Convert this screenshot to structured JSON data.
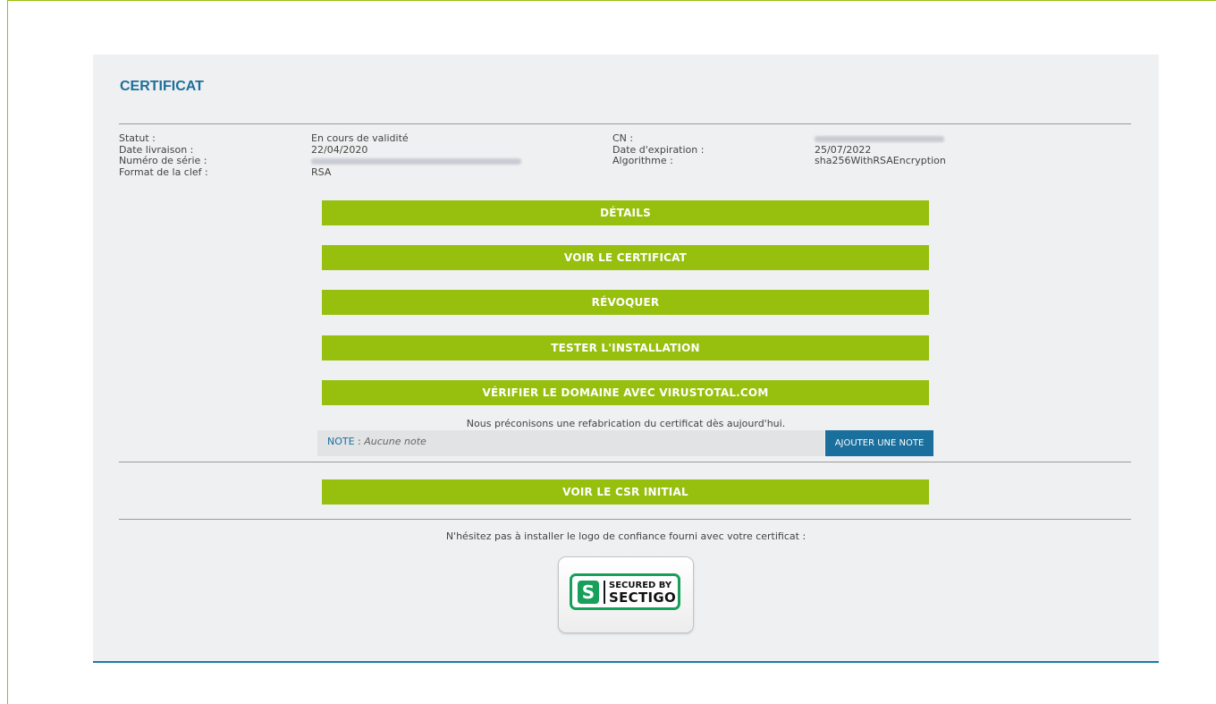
{
  "certificate": {
    "title": "CERTIFICAT",
    "left_labels": {
      "status": "Statut :",
      "delivery": "Date livraison :",
      "serial": "Numéro de série :",
      "key_format": "Format de la clef :"
    },
    "left_values": {
      "status": "En cours de validité",
      "delivery": "22/04/2020",
      "key_format": "RSA"
    },
    "right_labels": {
      "cn": "CN :",
      "expiration": "Date d'expiration :",
      "algorithm": "Algorithme :"
    },
    "right_values": {
      "expiration": "25/07/2022",
      "algorithm": "sha256WithRSAEncryption"
    }
  },
  "actions": {
    "details": "DÉTAILS",
    "view_certificate": "VOIR LE CERTIFICAT",
    "revoke": "RÉVOQUER",
    "test_install": "TESTER L'INSTALLATION",
    "verify_domain": "VÉRIFIER LE DOMAINE AVEC VIRUSTOTAL.COM",
    "view_csr": "VOIR LE CSR INITIAL"
  },
  "recommendation": "Nous préconisons une refabrication du certificat dès aujourd'hui.",
  "note": {
    "label": "NOTE",
    "separator": " : ",
    "value": "Aucune note",
    "add_button": "AJOUTER UNE NOTE"
  },
  "logo_hint": "N'hésitez pas à installer le logo de confiance fourni avec votre certificat :",
  "badge": {
    "line1": "SECURED BY",
    "line2": "SECTIGO",
    "brand_color": "#16a05a"
  },
  "colors": {
    "accent_green": "#97bf0d",
    "accent_blue": "#1b6f9c"
  }
}
